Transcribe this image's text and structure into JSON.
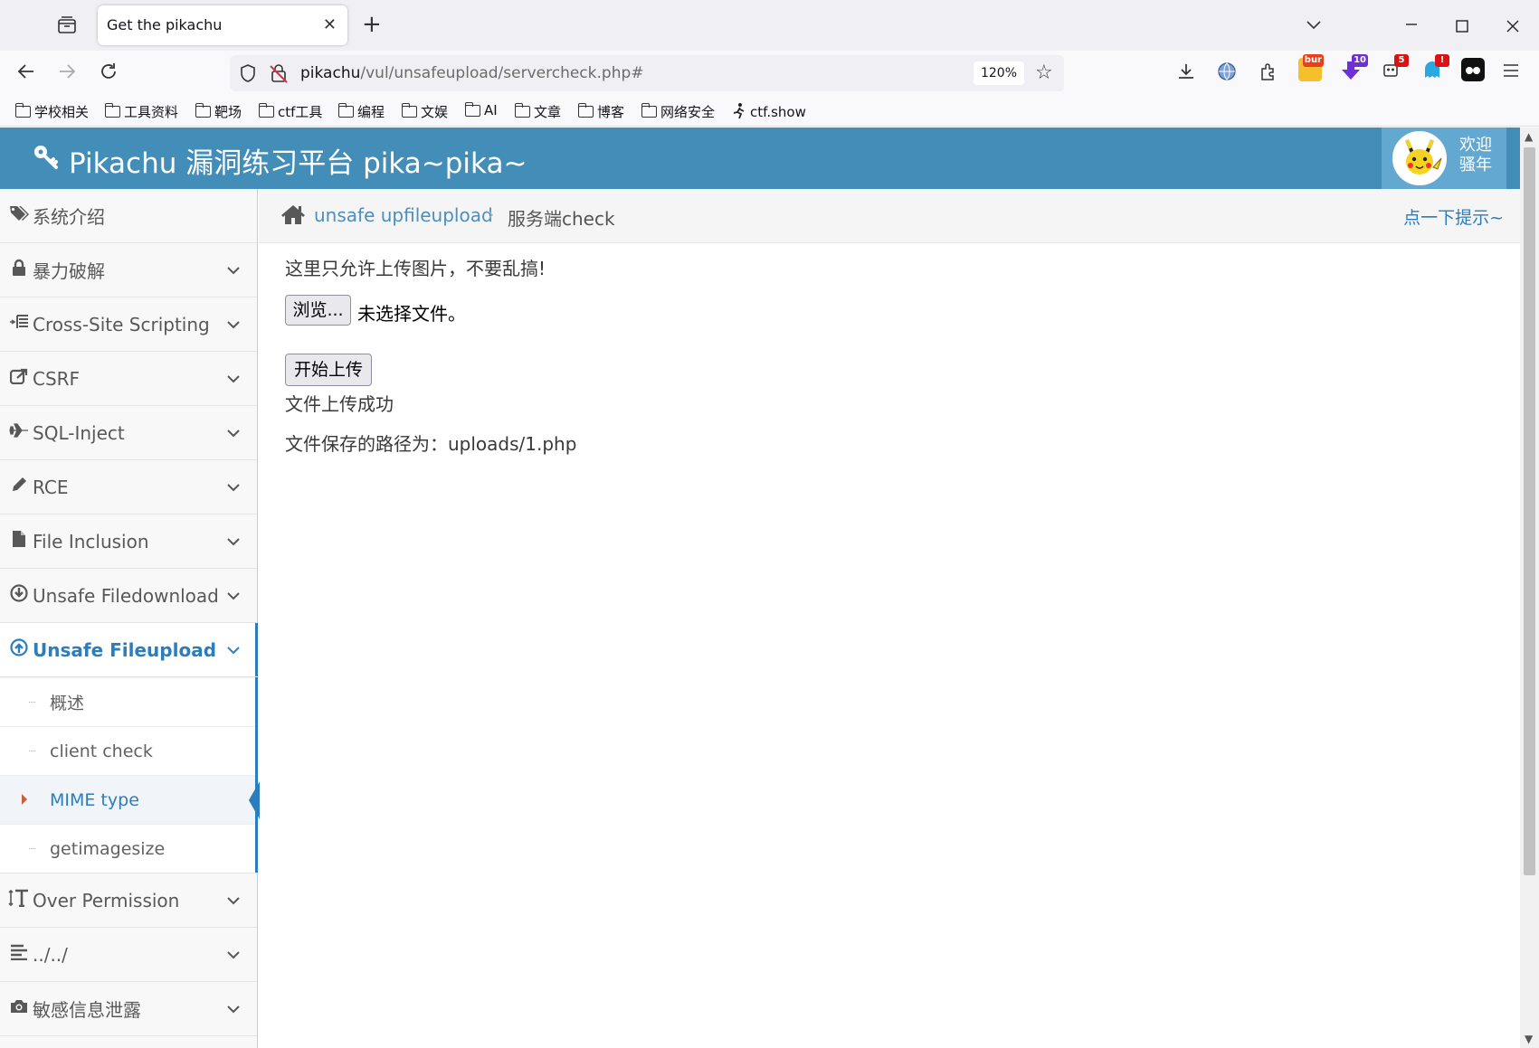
{
  "browser": {
    "tab_title": "Get the pikachu",
    "url_host": "pikachu",
    "url_path": "/vul/unsafeupload/servercheck.php#",
    "zoom": "120%",
    "extensions": [
      {
        "name": "burp",
        "badge": "bur",
        "color": "#e8401c"
      },
      {
        "name": "ext-10",
        "badge": "10",
        "color": "#6f2fd6"
      },
      {
        "name": "ext-5",
        "badge": "5",
        "color": "#d11"
      },
      {
        "name": "ext-alert",
        "badge": "!",
        "color": "#d11"
      }
    ],
    "bookmarks": [
      "学校相关",
      "工具资料",
      "靶场",
      "ctf工具",
      "编程",
      "文娱",
      "AI",
      "文章",
      "博客",
      "网络安全",
      "ctf.show"
    ]
  },
  "header": {
    "title": "Pikachu 漏洞练习平台 pika~pika~",
    "welcome": "欢迎骚年"
  },
  "sidebar": {
    "items": [
      {
        "label": "系统介绍",
        "icon": "tags-icon",
        "glyph": "🏷"
      },
      {
        "label": "暴力破解",
        "icon": "lock-icon",
        "glyph": "🔒"
      },
      {
        "label": "Cross-Site Scripting",
        "icon": "list-indent-icon",
        "glyph": "⁝☰"
      },
      {
        "label": "CSRF",
        "icon": "share-square-icon",
        "glyph": "⇱"
      },
      {
        "label": "SQL-Inject",
        "icon": "plane-icon",
        "glyph": "✈"
      },
      {
        "label": "RCE",
        "icon": "pencil-icon",
        "glyph": "✎"
      },
      {
        "label": "File Inclusion",
        "icon": "file-icon",
        "glyph": "▆"
      },
      {
        "label": "Unsafe Filedownload",
        "icon": "download-circle-icon",
        "glyph": "⊕"
      },
      {
        "label": "Unsafe Fileupload",
        "icon": "upload-circle-icon",
        "glyph": "⊕"
      },
      {
        "label": "Over Permission",
        "icon": "text-height-icon",
        "glyph": "↕T"
      },
      {
        "label": "../../",
        "icon": "align-left-icon",
        "glyph": "☰"
      },
      {
        "label": "敏感信息泄露",
        "icon": "camera-icon",
        "glyph": "📷"
      }
    ],
    "submenu": [
      "概述",
      "client check",
      "MIME type",
      "getimagesize"
    ]
  },
  "breadcrumb": {
    "link": "unsafe upfileupload",
    "current": "服务端check",
    "hint": "点一下提示~"
  },
  "content": {
    "notice": "这里只允许上传图片，不要乱搞!",
    "browse_label": "浏览...",
    "no_file": "未选择文件。",
    "upload_label": "开始上传",
    "success": "文件上传成功",
    "saved_path": "文件保存的路径为：uploads/1.php"
  },
  "colors": {
    "header_bg": "#438eb9",
    "accent": "#2b7dbc"
  }
}
